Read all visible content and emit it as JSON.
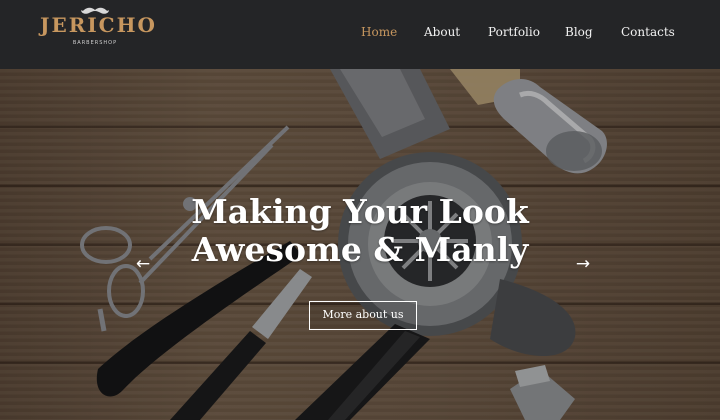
{
  "brand": {
    "name": "JERICHO",
    "tagline": "BARBERSHOP",
    "accent_color": "#c7975f",
    "icon": "mustache-icon"
  },
  "nav": {
    "items": [
      {
        "label": "Home",
        "active": true
      },
      {
        "label": "About",
        "active": false
      },
      {
        "label": "Portfolio",
        "active": false
      },
      {
        "label": "Blog",
        "active": false
      },
      {
        "label": "Contacts",
        "active": false
      }
    ]
  },
  "hero": {
    "title_line1": "Making Your Look",
    "title_line2": "Awesome & Manly",
    "cta_label": "More about us",
    "prev_icon": "arrow-left-icon",
    "next_icon": "arrow-right-icon",
    "prev_glyph": "←",
    "next_glyph": "→"
  }
}
